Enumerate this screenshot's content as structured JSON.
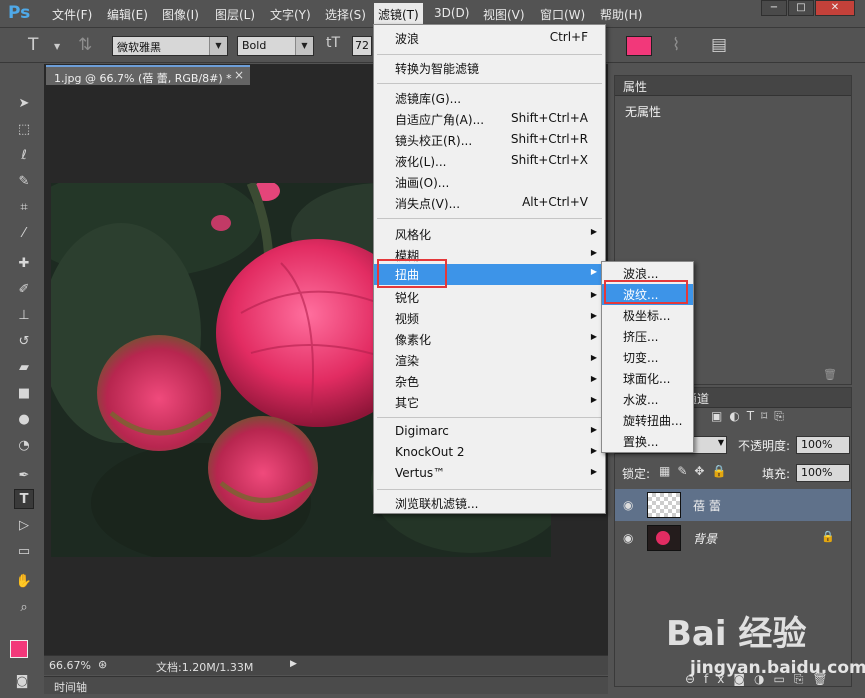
{
  "app": {
    "logo": "Ps",
    "menus": [
      "文件(F)",
      "编辑(E)",
      "图像(I)",
      "图层(L)",
      "文字(Y)",
      "选择(S)",
      "滤镜(T)",
      "3D(D)",
      "视图(V)",
      "窗口(W)",
      "帮助(H)"
    ],
    "active_menu": "滤镜(T)",
    "window_controls": [
      "−",
      "□",
      "✕"
    ]
  },
  "options": {
    "font_family": "微软雅黑",
    "font_style": "Bold",
    "font_size": "72",
    "text_color": "#f2387a"
  },
  "document": {
    "tab_title": "1.jpg @ 66.7% (蓓 蕾, RGB/8#) *",
    "tab_close": "×",
    "zoom": "66.67%",
    "doc_size": "文档:1.20M/1.33M",
    "timeline_label": "时间轴"
  },
  "properties": {
    "title": "属性",
    "content": "无属性"
  },
  "layers": {
    "channels_tab": "通道",
    "opacity_label": "不透明度:",
    "opacity_value": "100%",
    "lock_label": "锁定:",
    "fill_label": "填充:",
    "fill_value": "100%",
    "rows": [
      {
        "name": "蓓 蕾",
        "selected": true
      },
      {
        "name": "背景",
        "selected": false
      }
    ]
  },
  "filter_menu": {
    "items": [
      {
        "label": "波浪",
        "shortcut": "Ctrl+F"
      },
      {
        "label": "转换为智能滤镜",
        "shortcut": ""
      },
      {
        "label": "滤镜库(G)...",
        "shortcut": ""
      },
      {
        "label": "自适应广角(A)...",
        "shortcut": "Shift+Ctrl+A"
      },
      {
        "label": "镜头校正(R)...",
        "shortcut": "Shift+Ctrl+R"
      },
      {
        "label": "液化(L)...",
        "shortcut": "Shift+Ctrl+X"
      },
      {
        "label": "油画(O)...",
        "shortcut": ""
      },
      {
        "label": "消失点(V)...",
        "shortcut": "Alt+Ctrl+V"
      },
      {
        "label": "风格化",
        "shortcut": ""
      },
      {
        "label": "模糊",
        "shortcut": ""
      },
      {
        "label": "扭曲",
        "shortcut": ""
      },
      {
        "label": "锐化",
        "shortcut": ""
      },
      {
        "label": "视频",
        "shortcut": ""
      },
      {
        "label": "像素化",
        "shortcut": ""
      },
      {
        "label": "渲染",
        "shortcut": ""
      },
      {
        "label": "杂色",
        "shortcut": ""
      },
      {
        "label": "其它",
        "shortcut": ""
      },
      {
        "label": "Digimarc",
        "shortcut": ""
      },
      {
        "label": "KnockOut 2",
        "shortcut": ""
      },
      {
        "label": "Vertus™",
        "shortcut": ""
      },
      {
        "label": "浏览联机滤镜...",
        "shortcut": ""
      }
    ],
    "highlighted": "扭曲"
  },
  "distort_submenu": {
    "items": [
      "波浪...",
      "波纹...",
      "极坐标...",
      "挤压...",
      "切变...",
      "球面化...",
      "水波...",
      "旋转扭曲...",
      "置换..."
    ],
    "highlighted": "波纹..."
  },
  "watermark": {
    "logo": "Bai 经验",
    "url": "jingyan.baidu.com"
  },
  "colors": {
    "highlight": "#3d94e8",
    "annotation": "#e4383a",
    "foreground_swatch": "#f2387a"
  }
}
